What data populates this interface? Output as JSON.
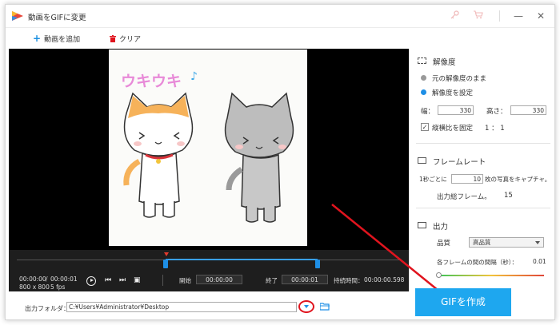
{
  "window": {
    "title": "動画をGIFに変更"
  },
  "toolbar": {
    "add_label": "動画を追加",
    "clear_label": "クリア"
  },
  "gif_text": "ウキウキ",
  "player": {
    "current_time": "00:00:00",
    "total_time": "00:00:01",
    "time_sep": "/",
    "resolution": "800 x 800",
    "fps": "5 fps",
    "start_label": "開始",
    "start_value": "00:00:00",
    "end_label": "終了",
    "end_value": "00:00:01",
    "duration_label": "持続時間：",
    "duration_value": "00:00:00.598"
  },
  "output": {
    "folder_label": "出力フォルダ：",
    "folder_path": "C:¥Users¥Administrator¥Desktop"
  },
  "resolution_section": {
    "title": "解像度",
    "option_original": "元の解像度のまま",
    "option_custom": "解像度を設定",
    "width_label": "幅：",
    "width_value": "330",
    "height_label": "高さ：",
    "height_value": "330",
    "aspect_label": "縦横比を固定",
    "aspect_value": "1 ： 1"
  },
  "framerate_section": {
    "title": "フレームレート",
    "per_sec_prefix": "1秒ごとに",
    "per_sec_value": "10",
    "per_sec_suffix": "枚の写真をキャプチャ。",
    "total_label": "出力総フレーム。",
    "total_value": "15"
  },
  "output_section": {
    "title": "出力",
    "quality_label": "品質",
    "quality_value": "高品質",
    "interval_label": "各フレームの間の間隔（秒）：",
    "interval_value": "0.01"
  },
  "create_button": "GIFを作成",
  "colors": {
    "accent": "#1ea7ef",
    "highlight": "#e0141e",
    "timeline_blue": "#1e8fe6"
  }
}
